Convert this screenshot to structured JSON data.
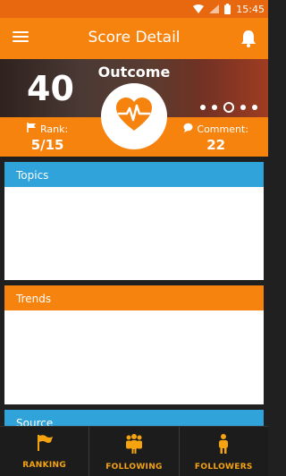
{
  "status_bar": {
    "time": "15:45",
    "icons": [
      "wifi-icon",
      "signal-icon",
      "battery-icon"
    ]
  },
  "app_bar": {
    "title": "Score Detail",
    "menu_icon": "menu-icon",
    "bell_icon": "bell-icon"
  },
  "hero": {
    "score": "40",
    "title": "Outcome",
    "pager_count": 5,
    "pager_active": 2,
    "center_icon": "heartbeat-icon"
  },
  "stats": {
    "rank_label": "Rank:",
    "rank_value": "5/15",
    "comment_label": "Comment:",
    "comment_value": "22"
  },
  "cards": {
    "topics": {
      "title": "Topics"
    },
    "trends": {
      "title": "Trends"
    },
    "source": {
      "title": "Source"
    }
  },
  "bottom_nav": {
    "ranking": "RANKING",
    "following": "FOLLOWING",
    "followers": "FOLLOWERS"
  },
  "colors": {
    "primary": "#f7830f",
    "primary_dark": "#e8680f",
    "accent_blue": "#2fa3da",
    "nav_label": "#f5a30f",
    "nav_bg": "#1c1c1c"
  }
}
